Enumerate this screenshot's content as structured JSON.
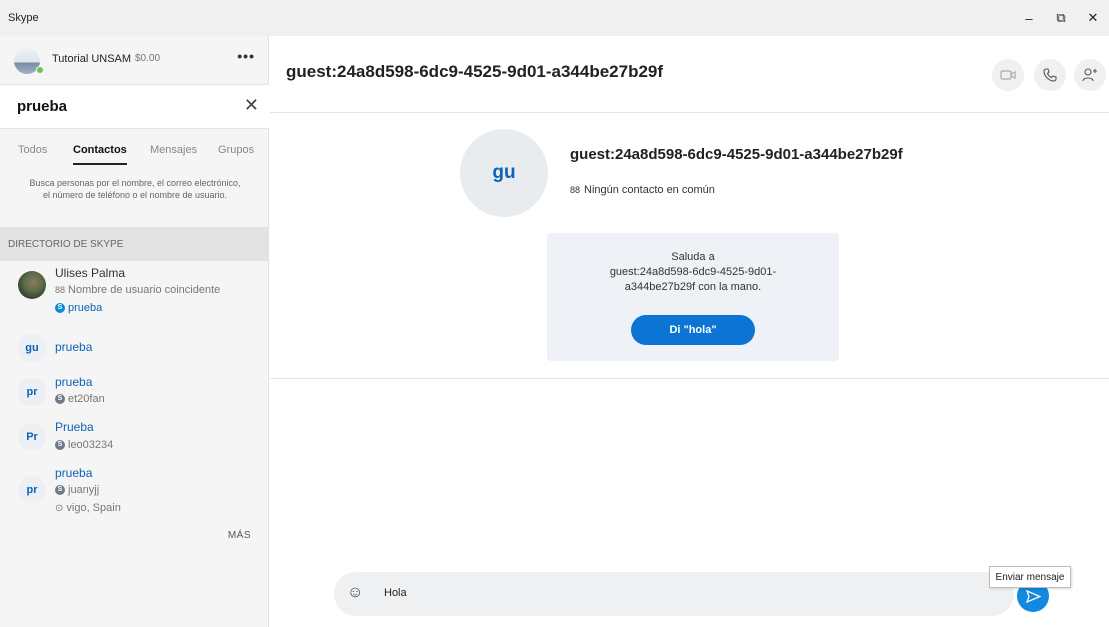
{
  "window": {
    "title": "Skype",
    "minimize": "–",
    "restore": "⧉",
    "close": "✕"
  },
  "profile": {
    "name": "Tutorial UNSAM",
    "credit": "$0.00",
    "more": "•••"
  },
  "search": {
    "query": "prueba",
    "clear": "✕"
  },
  "tabs": [
    {
      "label": "Todos"
    },
    {
      "label": "Contactos"
    },
    {
      "label": "Mensajes"
    },
    {
      "label": "Grupos"
    }
  ],
  "hint": "Busca personas por el nombre, el correo electrónico, el número de teléfono o el nombre de usuario.",
  "directory_header": "DIRECTORIO DE SKYPE",
  "contacts": [
    {
      "name": "Ulises Palma",
      "sub1": "Nombre de usuario coincidente",
      "sub2": "prueba"
    },
    {
      "initials": "gu",
      "name": "prueba"
    },
    {
      "initials": "pr",
      "name": "prueba",
      "sub1": "et20fan"
    },
    {
      "initials": "Pr",
      "name": "Prueba",
      "sub1": "leo03234"
    },
    {
      "initials": "pr",
      "name": "prueba",
      "sub1": "juanyjj",
      "sub2": "vigo, Spain"
    }
  ],
  "more_label": "MÁS",
  "chat": {
    "title": "guest:24a8d598-6dc9-4525-9d01-a344be27b29f",
    "avatar_initials": "gu",
    "contact_name": "guest:24a8d598-6dc9-4525-9d01-a344be27b29f",
    "common_contacts": "Ningún contacto en común",
    "greet_line1": "Saluda a",
    "greet_line2": "guest:24a8d598-6dc9-4525-9d01-",
    "greet_line3": "a344be27b29f con la mano.",
    "greet_button": "Di \"hola\"",
    "composer_text": "Hola",
    "send_tooltip": "Enviar mensaje"
  },
  "colors": {
    "accent": "#0b74d5",
    "online": "#6fc25b",
    "link": "#0b62b6"
  }
}
